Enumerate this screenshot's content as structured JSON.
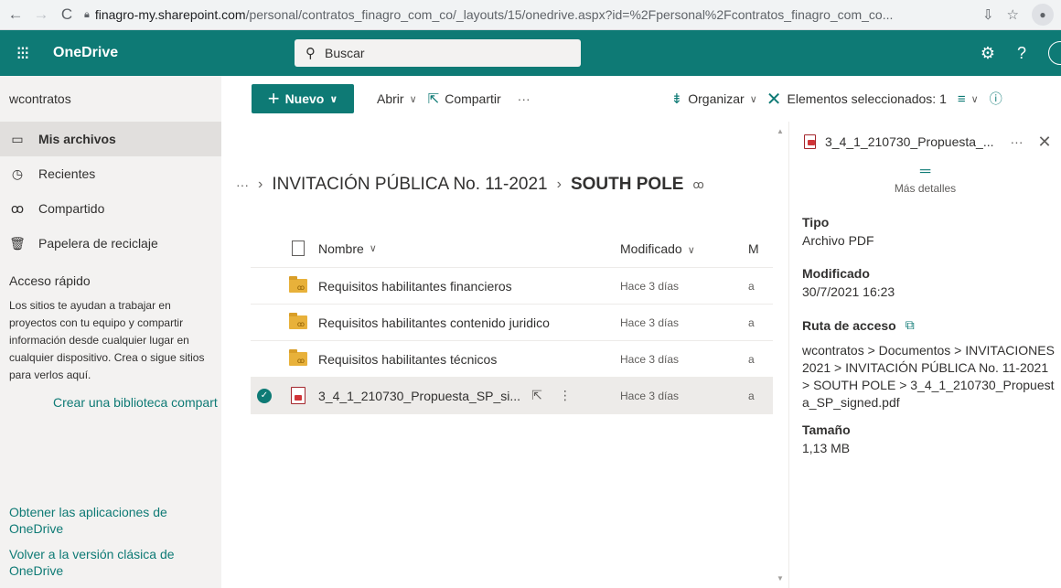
{
  "browser": {
    "url_host": "finagro-my.sharepoint.com",
    "url_path": "/personal/contratos_finagro_com_co/_layouts/15/onedrive.aspx?id=%2Fpersonal%2Fcontratos_finagro_com_co..."
  },
  "suite": {
    "app_name": "OneDrive",
    "search_placeholder": "Buscar",
    "help": "?"
  },
  "sidebar": {
    "user": "wcontratos",
    "items": [
      {
        "label": "Mis archivos",
        "icon": "folder-icon",
        "active": true
      },
      {
        "label": "Recientes",
        "icon": "clock-icon",
        "active": false
      },
      {
        "label": "Compartido",
        "icon": "people-icon",
        "active": false
      },
      {
        "label": "Papelera de reciclaje",
        "icon": "trash-icon",
        "active": false
      }
    ],
    "quick_access_title": "Acceso rápido",
    "quick_access_text": "Los sitios te ayudan a trabajar en proyectos con tu equipo y compartir información desde cualquier lugar en cualquier dispositivo. Crea o sigue sitios para verlos aquí.",
    "create_library_link": "Crear una biblioteca compart",
    "get_apps_link": "Obtener las aplicaciones de OneDrive",
    "classic_link": "Volver a la versión clásica de OneDrive"
  },
  "toolbar": {
    "new_label": "Nuevo",
    "open_label": "Abrir",
    "share_label": "Compartir",
    "sort_label": "Organizar",
    "selected_label": "Elementos seleccionados: 1"
  },
  "breadcrumb": {
    "ellipsis": "···",
    "parent": "INVITACIÓN PÚBLICA No. 11-2021",
    "current": "SOUTH POLE"
  },
  "list": {
    "columns": {
      "name": "Nombre",
      "modified": "Modificado",
      "extra": "M"
    },
    "rows": [
      {
        "name": "Requisitos habilitantes financieros",
        "modified": "Hace 3 días",
        "extra": "a",
        "type": "folder",
        "selected": false
      },
      {
        "name": "Requisitos habilitantes contenido juridico",
        "modified": "Hace 3 días",
        "extra": "a",
        "type": "folder",
        "selected": false
      },
      {
        "name": "Requisitos habilitantes técnicos",
        "modified": "Hace 3 días",
        "extra": "a",
        "type": "folder",
        "selected": false
      },
      {
        "name": "3_4_1_210730_Propuesta_SP_si...",
        "modified": "Hace 3 días",
        "extra": "a",
        "type": "pdf",
        "selected": true
      }
    ]
  },
  "details": {
    "title": "3_4_1_210730_Propuesta_...",
    "more_details": "Más detalles",
    "type_label": "Tipo",
    "type_value": "Archivo PDF",
    "modified_label": "Modificado",
    "modified_value": "30/7/2021 16:23",
    "path_label": "Ruta de acceso",
    "path_value": "wcontratos > Documentos > INVITACIONES 2021 > INVITACIÓN PÚBLICA No. 11-2021 > SOUTH POLE > 3_4_1_210730_Propuesta_SP_signed.pdf",
    "size_label": "Tamaño",
    "size_value": "1,13 MB"
  },
  "colors": {
    "brand": "#0e7a75",
    "sidebar_bg": "#f3f2f1"
  }
}
